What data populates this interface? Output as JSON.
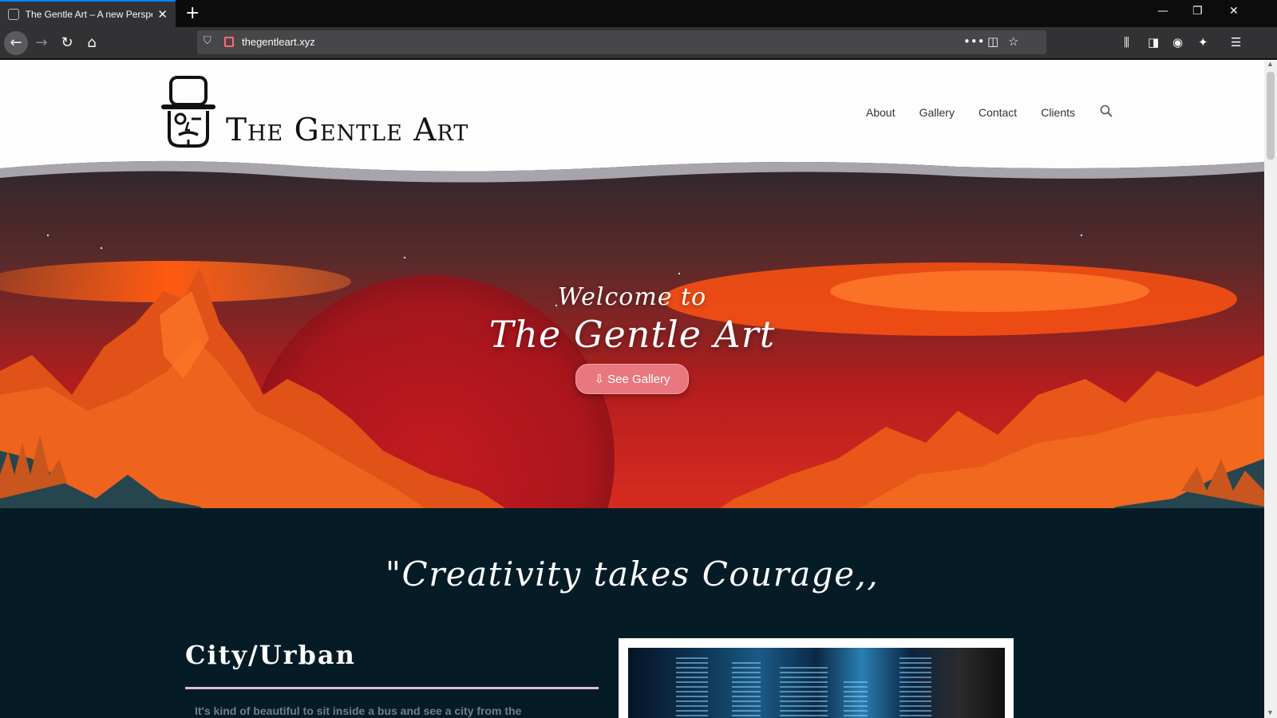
{
  "browser": {
    "tab_title": "The Gentle Art – A new Perspec",
    "tab_close": "✕",
    "new_tab": "+",
    "url": "thegentleart.xyz",
    "window": {
      "minimize": "—",
      "restore": "❐",
      "close": "✕"
    }
  },
  "site": {
    "logo_text": "The Gentle Art",
    "nav": [
      "About",
      "Gallery",
      "Contact",
      "Clients"
    ]
  },
  "hero": {
    "welcome": "Welcome to",
    "title": "The Gentle Art",
    "button": "⇩ See Gallery"
  },
  "content": {
    "quote": "\"Creativity takes Courage,,",
    "category_title": "City/Urban",
    "category_text": "It's kind of beautiful to sit inside a bus and see a city from the"
  },
  "colors": {
    "accent": "#0a84ff",
    "hero_button": "#e8787e",
    "dark_section": "#051c27",
    "rule": "#e1b8e6"
  }
}
